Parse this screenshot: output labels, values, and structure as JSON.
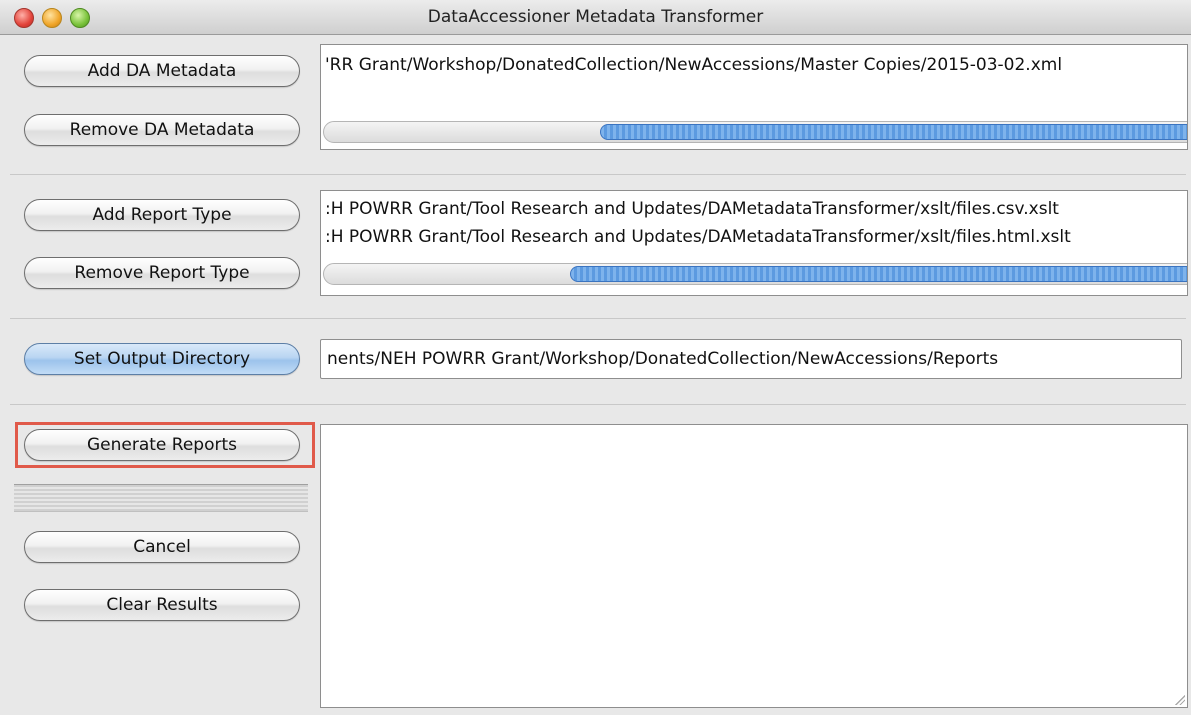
{
  "window": {
    "title": "DataAccessioner Metadata Transformer"
  },
  "metadata": {
    "add_label": "Add DA Metadata",
    "remove_label": "Remove DA Metadata",
    "files": [
      "'RR Grant/Workshop/DonatedCollection/NewAccessions/Master Copies/2015-03-02.xml"
    ]
  },
  "report": {
    "add_label": "Add Report Type",
    "remove_label": "Remove Report Type",
    "files": [
      ":H POWRR Grant/Tool Research and Updates/DAMetadataTransformer/xslt/files.csv.xslt",
      ":H POWRR Grant/Tool Research and Updates/DAMetadataTransformer/xslt/files.html.xslt"
    ]
  },
  "output": {
    "set_label": "Set Output Directory",
    "value": "nents/NEH POWRR Grant/Workshop/DonatedCollection/NewAccessions/Reports"
  },
  "actions": {
    "generate_label": "Generate Reports",
    "cancel_label": "Cancel",
    "clear_label": "Clear Results"
  },
  "results": {
    "text": ""
  }
}
